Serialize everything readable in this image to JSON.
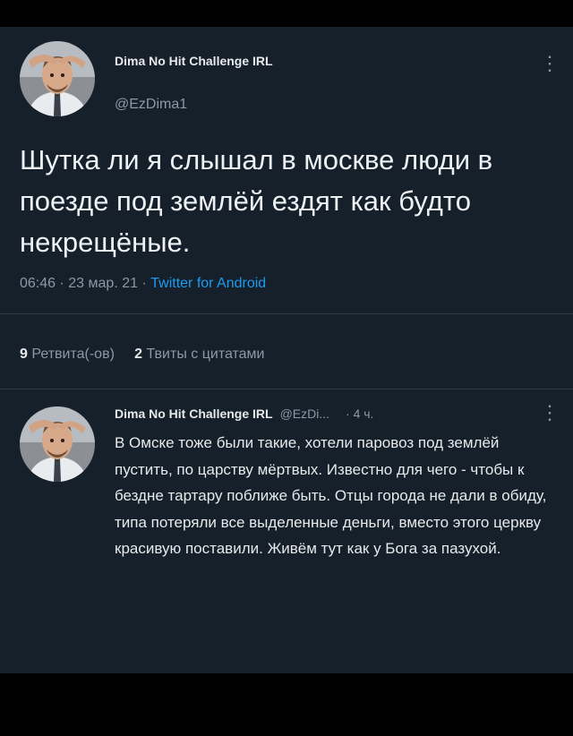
{
  "tweet": {
    "author_name": "Dima No Hit Challenge IRL",
    "author_handle": "@EzDima1",
    "text": "Шутка ли я слышал в москве люди в поезде под землёй ездят как будто некрещёные.",
    "time": "06:46",
    "date": "23 мар. 21",
    "source": "Twitter for Android",
    "retweets_count": "9",
    "retweets_label": "Ретвита(-ов)",
    "quotes_count": "2",
    "quotes_label": "Твиты с цитатами",
    "more_glyph": "⋮"
  },
  "reply": {
    "author_name": "Dima No Hit Challenge IRL",
    "author_handle": "@EzDi...",
    "time": "· 4 ч.",
    "text": "В Омске тоже были такие, хотели паровоз под землёй пустить, по царству мёртвых. Известно для чего - чтобы к бездне тартару поближе быть. Отцы города не дали в обиду, типа потеряли все выделенные деньги, вместо этого церкву красивую поставили. Живём тут как у Бога за пазухой.",
    "more_glyph": "⋮"
  },
  "colors": {
    "background": "#15202b",
    "text": "#e7e9ea",
    "secondary_text": "#8b98a5",
    "link": "#1d9bf0",
    "divider": "#2f3b47"
  }
}
